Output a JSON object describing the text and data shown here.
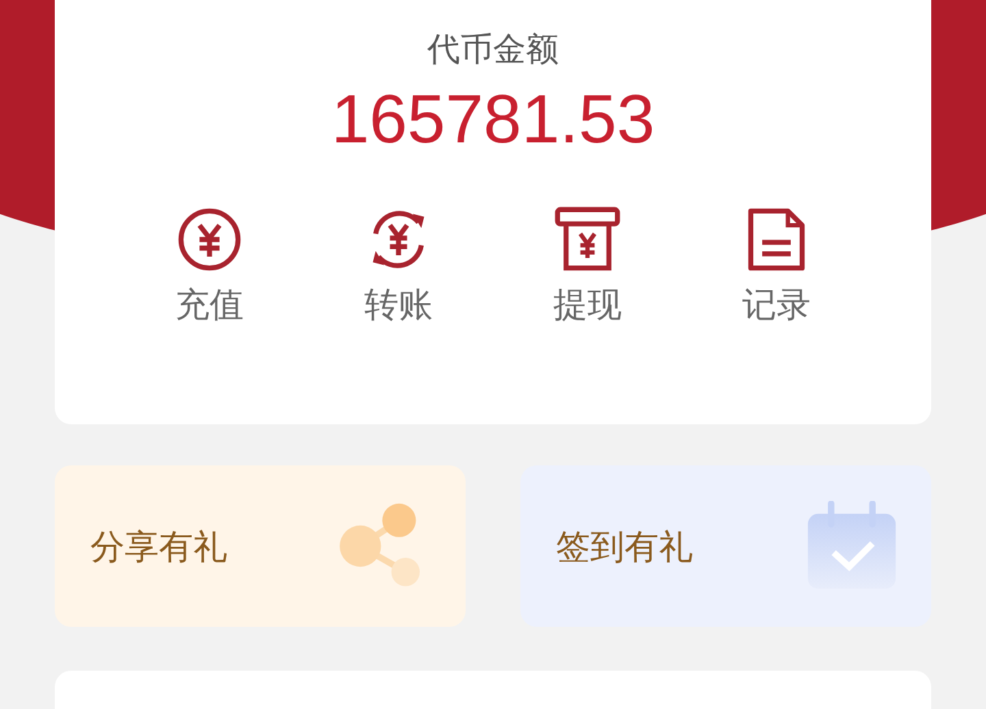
{
  "balance": {
    "label": "代币金额",
    "amount": "165781.53"
  },
  "actions": [
    {
      "kind": "recharge",
      "label": "充值"
    },
    {
      "kind": "transfer",
      "label": "转账"
    },
    {
      "kind": "withdraw",
      "label": "提现"
    },
    {
      "kind": "records",
      "label": "记录"
    }
  ],
  "promos": [
    {
      "kind": "share",
      "label": "分享有礼"
    },
    {
      "kind": "checkin",
      "label": "签到有礼"
    }
  ]
}
